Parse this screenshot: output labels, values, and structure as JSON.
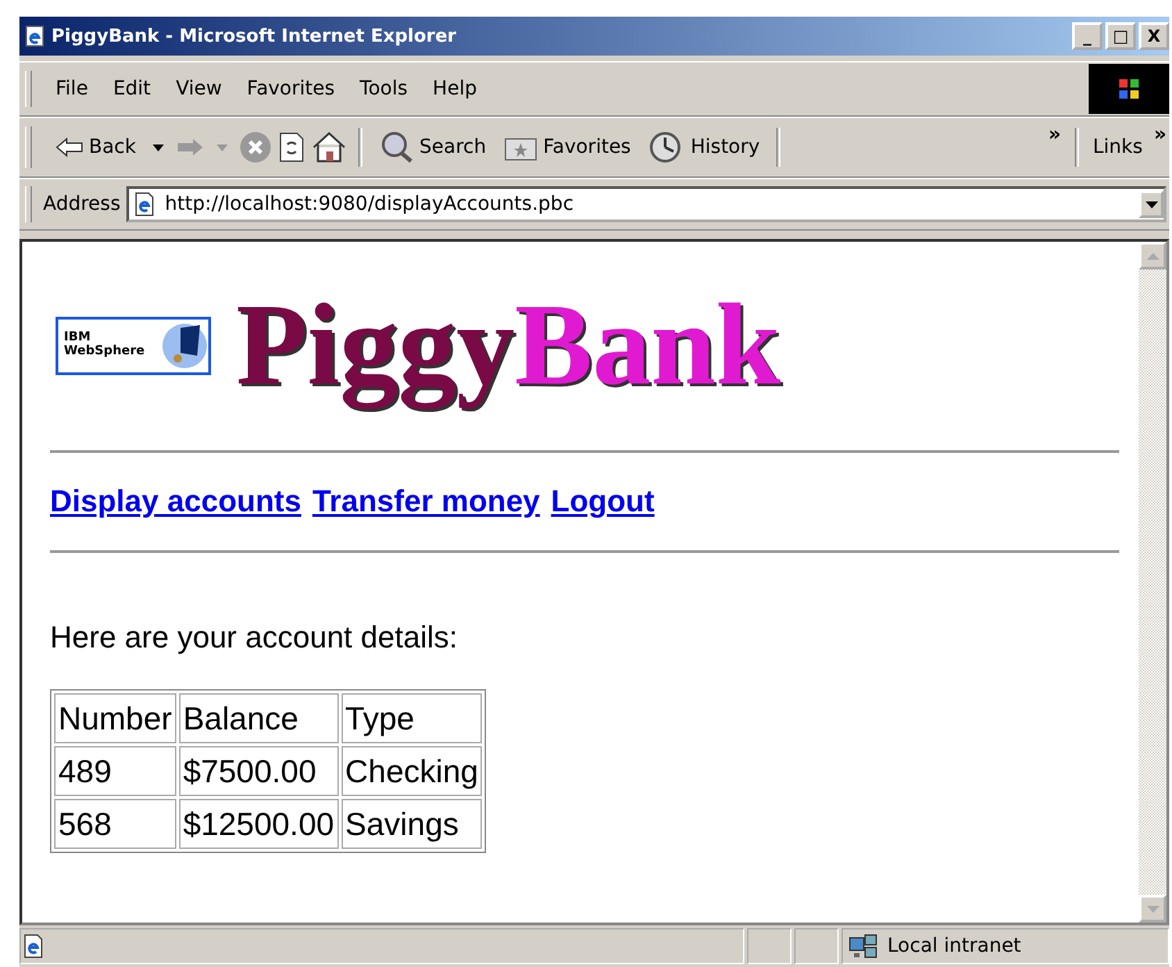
{
  "window": {
    "title": "PiggyBank - Microsoft Internet Explorer",
    "controls": [
      "_",
      "□",
      "X"
    ]
  },
  "menu": [
    "File",
    "Edit",
    "View",
    "Favorites",
    "Tools",
    "Help"
  ],
  "toolbar": {
    "back": "Back",
    "search": "Search",
    "favorites": "Favorites",
    "history": "History",
    "more": "»",
    "links": "Links",
    "links_more": "»"
  },
  "address": {
    "label": "Address",
    "value": "http://localhost:9080/displayAccounts.pbc"
  },
  "page": {
    "badge": [
      "IBM",
      "WebSphere"
    ],
    "logo": [
      {
        "text": "Piggy",
        "color": "#7a0a45"
      },
      {
        "text": "Bank",
        "color": "#e01ad0"
      }
    ],
    "nav_links": [
      "Display accounts",
      "Transfer money",
      "Logout"
    ],
    "intro": "Here are your account details:",
    "table": {
      "columns": [
        "Number",
        "Balance",
        "Type"
      ],
      "rows": [
        [
          "489",
          "$7500.00",
          "Checking"
        ],
        [
          "568",
          "$12500.00",
          "Savings"
        ]
      ]
    }
  },
  "status_bar": {
    "zone": "Local intranet"
  }
}
